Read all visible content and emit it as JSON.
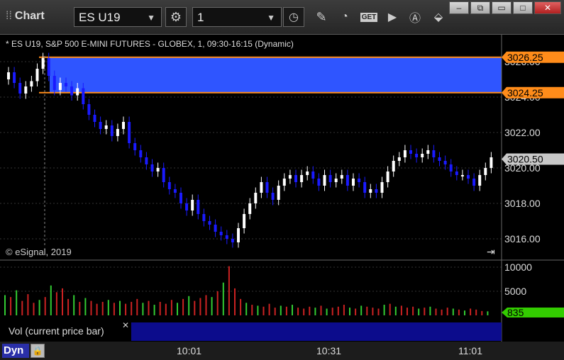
{
  "toolbar": {
    "title": "Chart",
    "symbol_value": "ES U19",
    "interval_value": "1"
  },
  "chart": {
    "header": "* ES U19, S&P 500 E-MINI FUTURES - GLOBEX, 1, 09:30-16:15 (Dynamic)",
    "watermark": "© eSignal, 2019",
    "price_ticks": [
      "3016.00",
      "3018.00",
      "3020.00",
      "3022.00",
      "3024.00",
      "3026.00"
    ],
    "band_top_label": "3026.25",
    "band_bottom_label": "3024.25",
    "current_price_label": "3020.50",
    "volume_ticks": [
      "10000",
      "5000"
    ],
    "current_volume_label": "835",
    "volume_study_label": "Vol (current price bar)",
    "time_labels": [
      "10:01",
      "10:31",
      "11:01"
    ],
    "mode_label": "Dyn",
    "colors": {
      "band": "#2f55ff",
      "band_line": "#ff8c1a",
      "up_bar": "#ffffff",
      "down_bar": "#1a1aff",
      "volume_up": "#33cc33",
      "volume_down": "#cc2222",
      "volume_label_bg": "#33cc00"
    }
  }
}
